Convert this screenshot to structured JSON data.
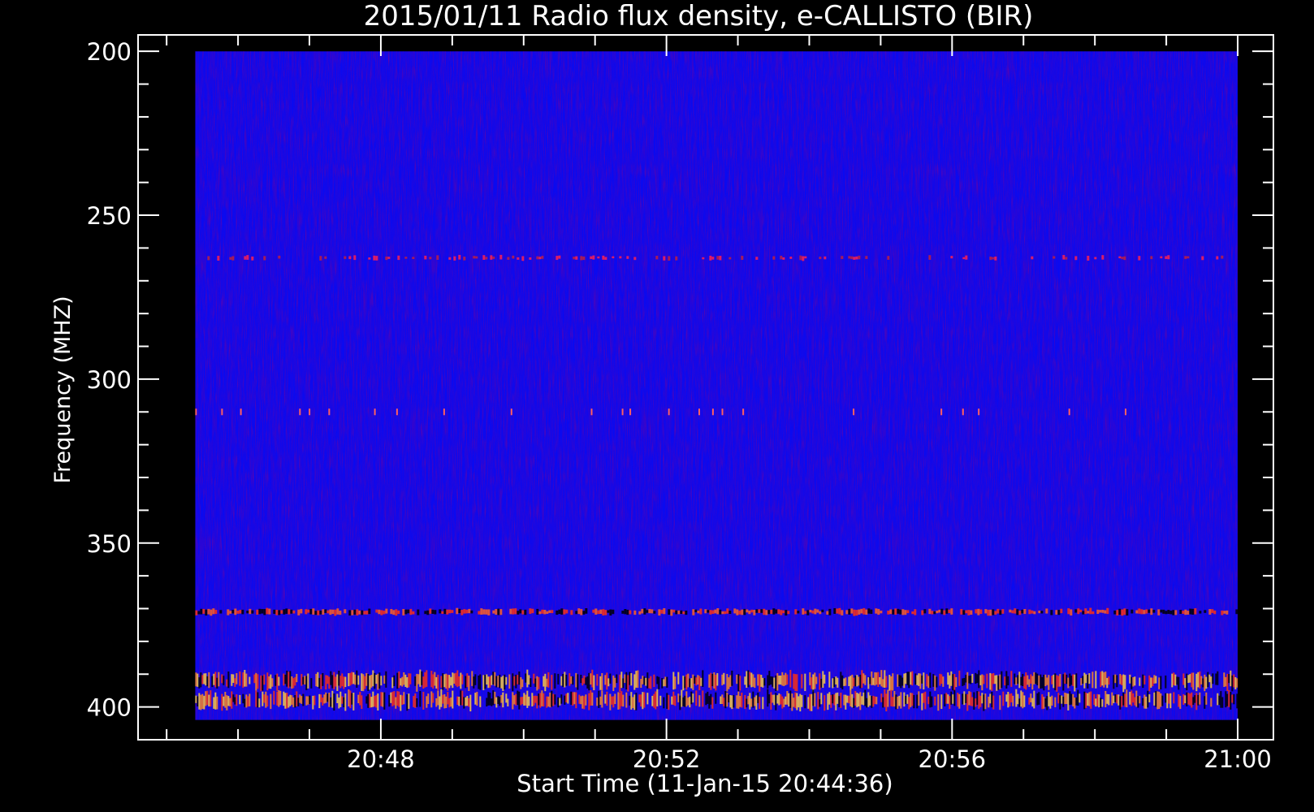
{
  "chart_data": {
    "type": "heatmap",
    "title": "2015/01/11  Radio flux density, e-CALLISTO (BIR)",
    "xlabel": "Start Time (11-Jan-15 20:44:36)",
    "ylabel": "Frequency (MHZ)",
    "x_ticks": [
      "20:48",
      "20:52",
      "20:56",
      "21:00"
    ],
    "y_ticks": [
      "200",
      "250",
      "300",
      "350",
      "400"
    ],
    "y_range_mhz": [
      195,
      410
    ],
    "data_y_range_mhz": [
      200,
      404
    ],
    "x_range_minutes": [
      "20:44:36",
      "21:00:30"
    ],
    "data_x_range_minutes": [
      "20:45:24",
      "21:00"
    ],
    "colorscale": [
      "#000000",
      "#1010ff",
      "#3a16e0",
      "#ff2020",
      "#ffa020",
      "#ffff60"
    ],
    "background_color": "#0a0af0",
    "grid": false,
    "features": [
      {
        "kind": "interference band",
        "freq_mhz": 371,
        "intensity": "moderate"
      },
      {
        "kind": "interference band",
        "freq_mhz": 392,
        "intensity": "strong"
      },
      {
        "kind": "interference band",
        "freq_mhz": 398,
        "intensity": "strong"
      },
      {
        "kind": "faint band",
        "freq_mhz": 263,
        "intensity": "weak"
      },
      {
        "kind": "spikes",
        "freq_mhz": 310,
        "intensity": "weak"
      }
    ]
  }
}
